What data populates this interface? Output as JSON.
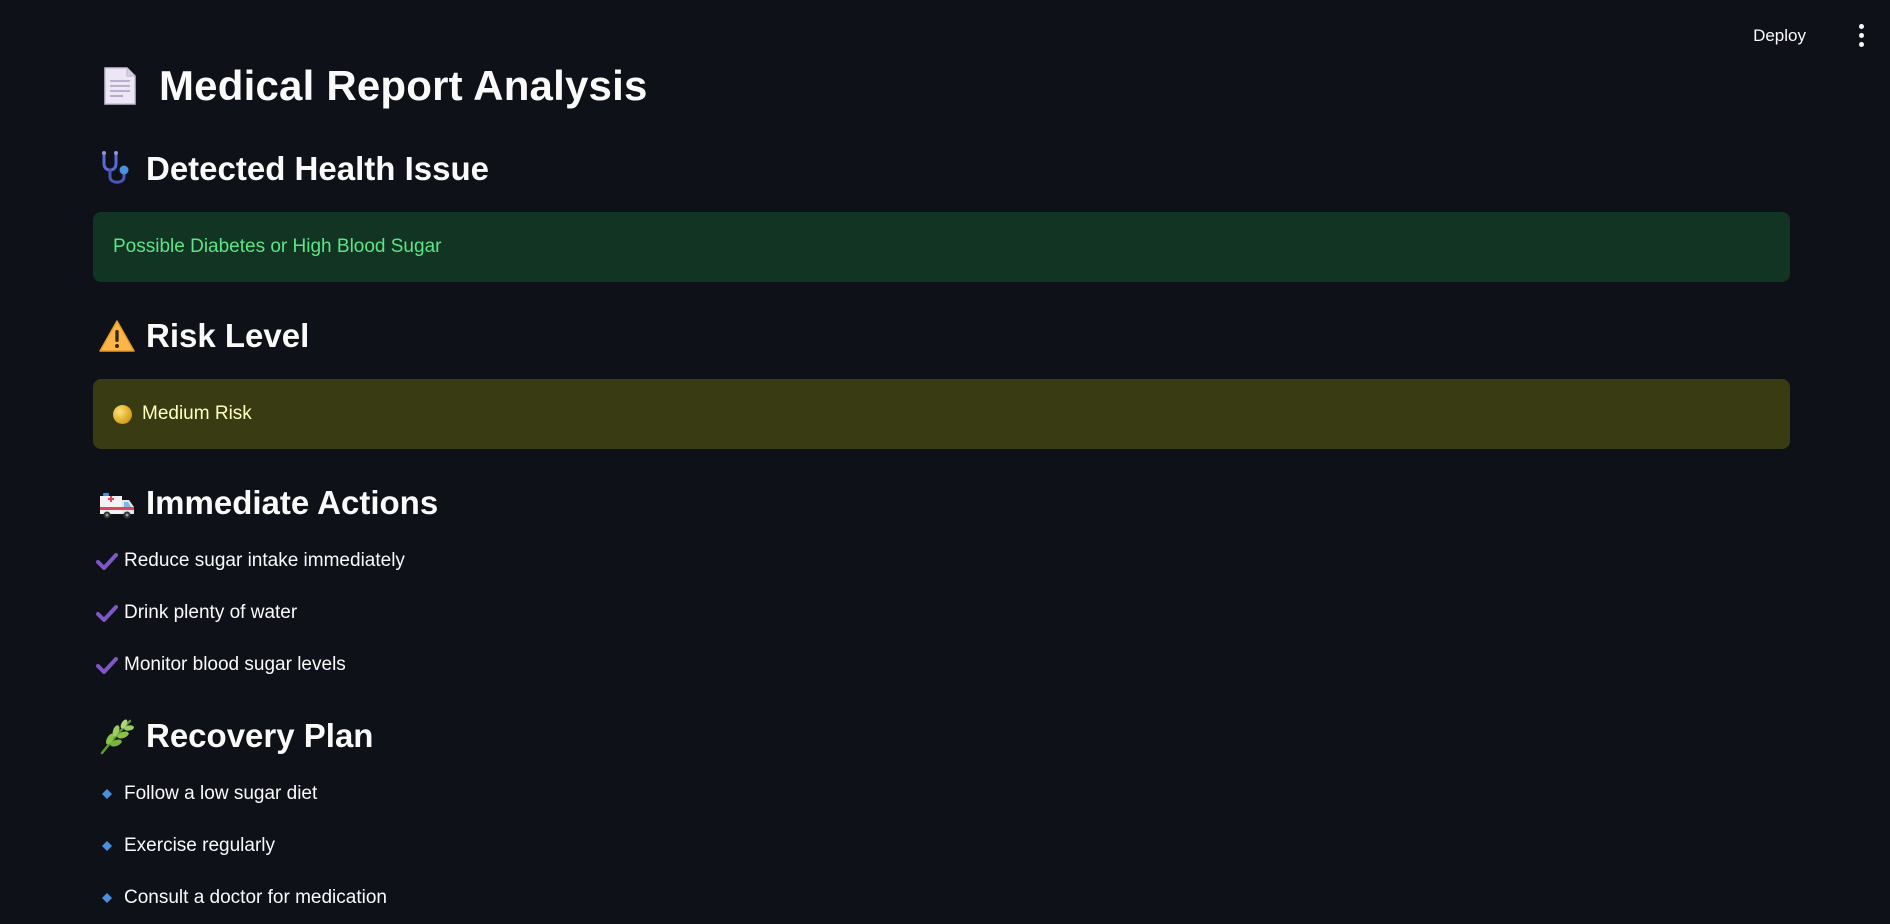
{
  "toolbar": {
    "deploy_label": "Deploy",
    "menu_icon": "more-vertical-icon"
  },
  "page": {
    "title": "Medical Report Analysis",
    "title_icon": "document-icon"
  },
  "sections": {
    "health_issue": {
      "heading": "Detected Health Issue",
      "icon": "stethoscope-icon",
      "message": "Possible Diabetes or High Blood Sugar"
    },
    "risk": {
      "heading": "Risk Level",
      "icon": "warning-icon",
      "message": "Medium Risk",
      "indicator_icon": "yellow-circle-icon"
    },
    "actions": {
      "heading": "Immediate Actions",
      "icon": "ambulance-icon",
      "items": [
        "Reduce sugar intake immediately",
        "Drink plenty of water",
        "Monitor blood sugar levels"
      ]
    },
    "recovery": {
      "heading": "Recovery Plan",
      "icon": "herb-icon",
      "items": [
        "Follow a low sugar diet",
        "Exercise regularly",
        "Consult a doctor for medication"
      ]
    }
  },
  "colors": {
    "background": "#0e1117",
    "success_text": "#5ce488",
    "warning_text": "#ffffc2",
    "check": "#7e57c2",
    "diamond": "#4a8fe0"
  }
}
